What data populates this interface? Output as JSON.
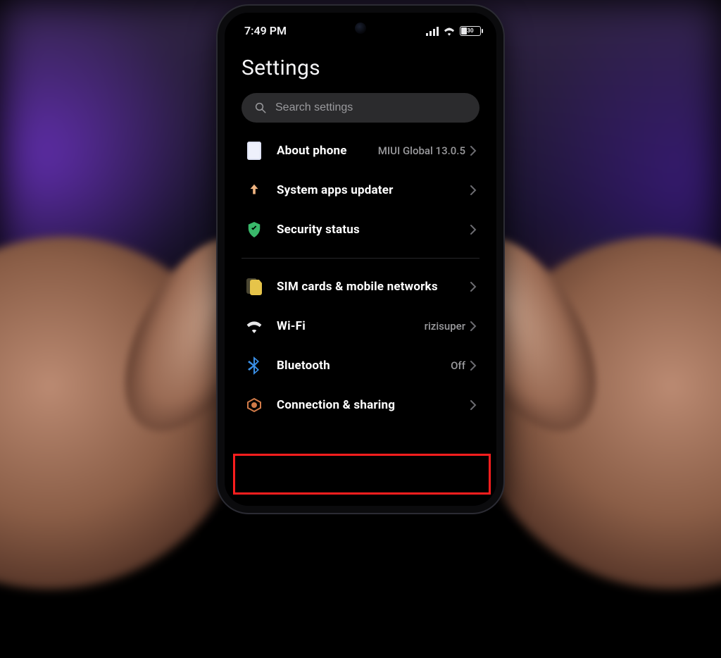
{
  "status": {
    "time": "7:49 PM",
    "battery_percent": "30"
  },
  "header": {
    "title": "Settings"
  },
  "search": {
    "placeholder": "Search settings"
  },
  "rows": {
    "about": {
      "label": "About phone",
      "value": "MIUI Global 13.0.5"
    },
    "updater": {
      "label": "System apps updater",
      "value": ""
    },
    "security": {
      "label": "Security status",
      "value": ""
    },
    "sim": {
      "label": "SIM cards & mobile networks",
      "value": ""
    },
    "wifi": {
      "label": "Wi-Fi",
      "value": "rizisuper"
    },
    "bluetooth": {
      "label": "Bluetooth",
      "value": "Off"
    },
    "conn": {
      "label": "Connection & sharing",
      "value": ""
    }
  }
}
